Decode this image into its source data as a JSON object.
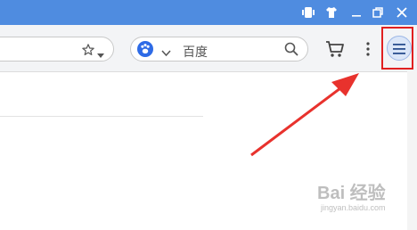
{
  "toolbar": {
    "search_placeholder": "百度"
  },
  "watermark": {
    "brand": "Bai 经验",
    "url": "jingyan.baidu.com"
  },
  "colors": {
    "titlebar": "#4f8ce0",
    "highlight": "#e02020",
    "arrow": "#e8322d"
  }
}
